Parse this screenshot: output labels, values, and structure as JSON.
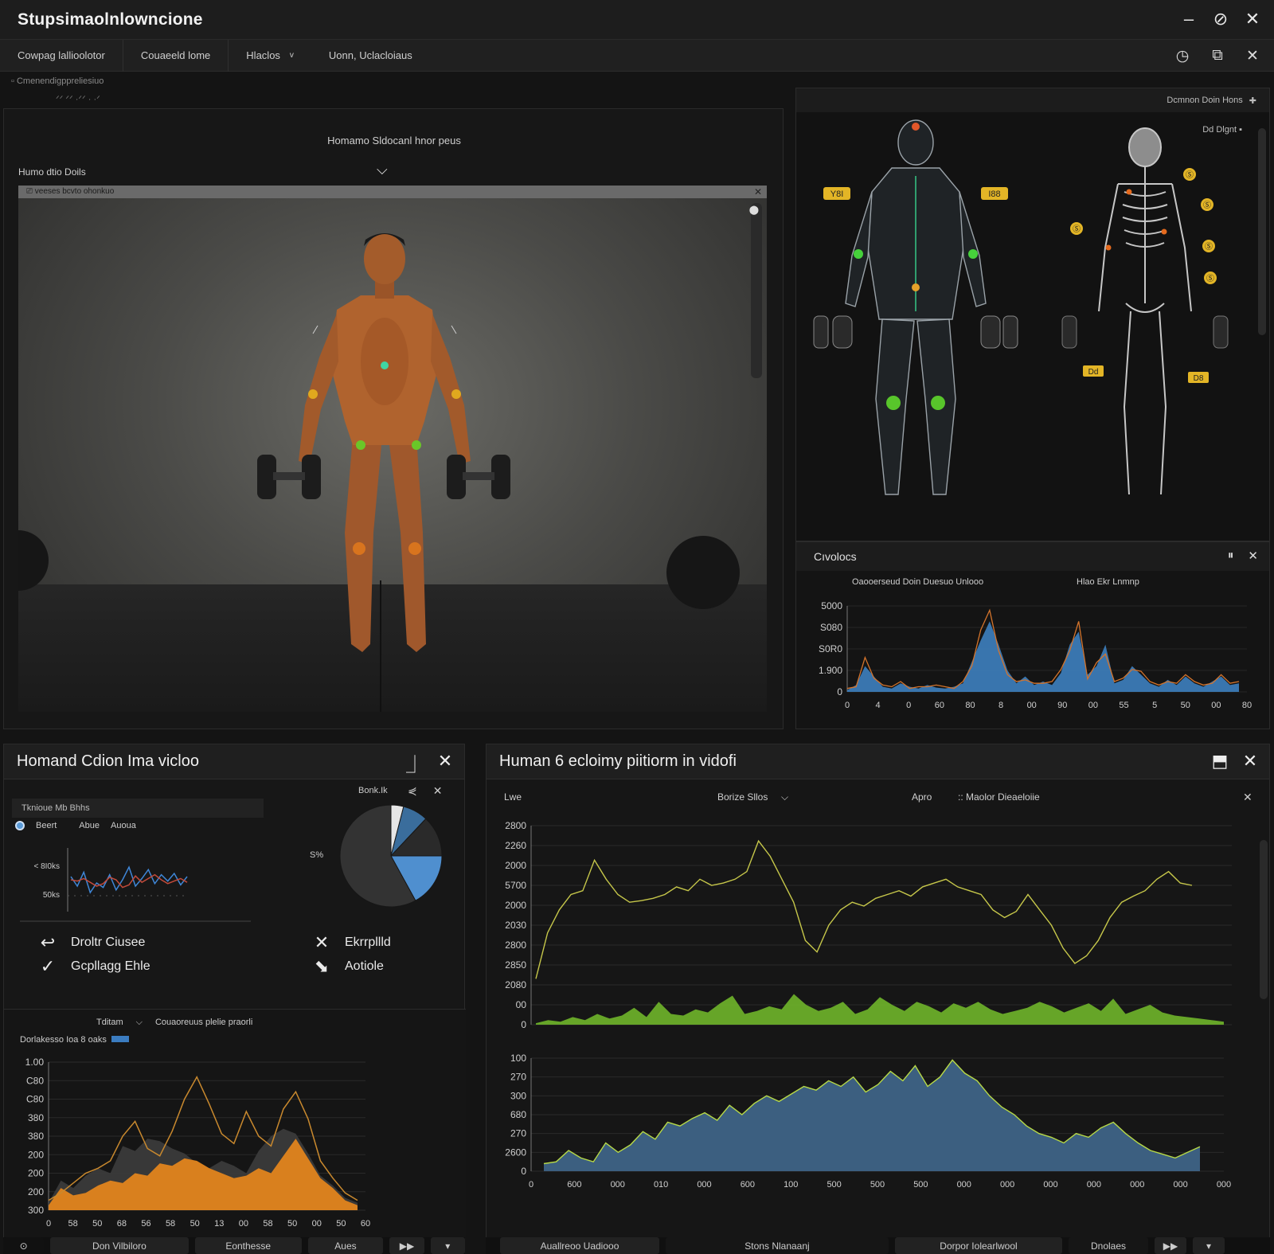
{
  "app": {
    "title": "Stupsimaolnlowncione",
    "window_controls": {
      "minimize": "–",
      "pin": "⊘",
      "close": "✕"
    }
  },
  "menu": {
    "items": [
      "Cowpag lallioolotor",
      "Couaeeld lome",
      "Hlaclos",
      "Uonn, Uclacloiaus"
    ],
    "dropdown_glyph": "v",
    "controls": {
      "history": "◷",
      "capture": "⧉",
      "close": "✕"
    }
  },
  "breadcrumb": {
    "text": "▫  Cmenendigppreliesiuo",
    "sub": "ᐟᐟ  ᐟᐟ ·ᐟᐟ  · ·ᐟ"
  },
  "video_panel": {
    "heading": "Homamo Sldocanl hnor peus",
    "subheading": "Humo dtio Doils",
    "chevron": "⌵",
    "strip_label": "⎚ veeses bcvto ohonkuo",
    "strip_close": "✕",
    "scroll_icon": "⬤"
  },
  "anatomy_panel": {
    "top_label": "Dcmnon  Doin Hons",
    "top_icon": "✚",
    "side_label": "Dd Dlgnt  ▪",
    "muscle_tags": [
      "Y8I",
      "I88"
    ],
    "skeleton_tags": [
      "Ⓢ",
      "Ⓢ",
      "Ⓢ",
      "Ⓢ",
      "Ⓢ",
      "Dd",
      "D8"
    ]
  },
  "cycle_panel": {
    "title": "Cıvolocs",
    "icons": {
      "pause": "⏸",
      "close": "✕"
    },
    "caption_left": "Oaooerseud Doin Duesuo Unlooo",
    "caption_right": "Hlao  Ekr Lnmnp",
    "chart_data": {
      "type": "area",
      "y_ticks": [
        "5000",
        "S080",
        "S0R0",
        "1.900",
        "0"
      ],
      "x_ticks": [
        "0",
        "4",
        "0",
        "60",
        "80",
        "8",
        "00",
        "90",
        "00",
        "55",
        "5",
        "50",
        "00",
        "80"
      ],
      "series": [
        {
          "values": [
            2,
            8,
            30,
            18,
            6,
            4,
            10,
            6,
            4,
            8,
            5,
            4,
            6,
            10,
            35,
            60,
            82,
            55,
            25,
            10,
            18,
            8,
            12,
            8,
            22,
            55,
            70,
            20,
            30,
            55,
            10,
            14,
            30,
            20,
            10,
            6,
            14,
            8,
            18,
            10,
            6,
            12,
            18,
            8,
            10
          ]
        },
        {
          "values": [
            4,
            6,
            40,
            16,
            8,
            6,
            12,
            4,
            6,
            6,
            8,
            6,
            4,
            12,
            30,
            72,
            95,
            48,
            20,
            12,
            14,
            10,
            10,
            12,
            26,
            48,
            82,
            15,
            34,
            44,
            12,
            16,
            26,
            24,
            12,
            8,
            12,
            10,
            20,
            12,
            8,
            10,
            20,
            10,
            12
          ]
        }
      ],
      "colors": [
        "#3d7fbf",
        "#d4742c"
      ],
      "ylim": [
        0,
        100
      ]
    }
  },
  "bl_panel": {
    "title": "Homand Cdion Ima vicloo",
    "icons": {
      "dock": "⏌",
      "close": "✕"
    },
    "sub_label": "Tknioue Mb Bhhs",
    "pie_label": "Bonk.Ik",
    "pie_icons": {
      "back": "⋞",
      "close": "✕"
    },
    "legend": {
      "a": "Beert",
      "b": "Abue",
      "c": "Auoua"
    },
    "mini_chart": {
      "y_ticks": [
        "< 8I0ks",
        "50ks"
      ],
      "series": [
        {
          "values": [
            55,
            40,
            62,
            30,
            45,
            38,
            58,
            34,
            50,
            70,
            40,
            52,
            66,
            44,
            58,
            48,
            60,
            42,
            55
          ],
          "color": "#3f87d8"
        },
        {
          "values": [
            50,
            48,
            52,
            46,
            40,
            44,
            54,
            50,
            38,
            42,
            56,
            46,
            52,
            58,
            50,
            44,
            48,
            52,
            46
          ],
          "color": "#c24a3a"
        }
      ]
    },
    "pie": {
      "slices": [
        0.04,
        0.08,
        0.13,
        0.17,
        0.58
      ],
      "colors": [
        "#e6e6e6",
        "#3a6d9c",
        "#2a2a2a",
        "#4f8fcf",
        "#333333"
      ],
      "left_label": "S%"
    },
    "actions": [
      {
        "icon": "↩",
        "label": "Droltr Ciusee"
      },
      {
        "icon": "✓",
        "label": "Gcpllagg Ehle"
      },
      {
        "icon": "✕",
        "label": "Ekrrpllld"
      },
      {
        "icon": "⬊",
        "label": "Aotiole"
      }
    ],
    "filter": {
      "a": "Tditam",
      "b": "⌵",
      "c": "Couaoreuus plelie praorli"
    },
    "range_label": "Dorlakesso Ioa 8 oaks",
    "area_chart": {
      "type": "area",
      "y_ticks": [
        "1.00",
        "C80",
        "C80",
        "380",
        "380",
        "200",
        "200",
        "200",
        "300"
      ],
      "x_ticks": [
        "0",
        "58",
        "50",
        "68",
        "56",
        "58",
        "50",
        "13",
        "00",
        "58",
        "50",
        "00",
        "50",
        "60"
      ],
      "series": [
        {
          "name": "",
          "values": [
            4,
            18,
            12,
            14,
            20,
            24,
            22,
            30,
            28,
            38,
            36,
            42,
            40,
            34,
            30,
            26,
            28,
            34,
            30,
            44,
            58,
            42,
            26,
            18,
            8,
            4
          ],
          "color": "#d9801e"
        },
        {
          "name": "",
          "values": [
            6,
            24,
            18,
            28,
            34,
            30,
            52,
            48,
            58,
            56,
            50,
            46,
            38,
            34,
            40,
            36,
            30,
            48,
            60,
            66,
            62,
            46,
            28,
            20,
            10,
            6
          ],
          "color": "#3a3a3a"
        },
        {
          "name": "",
          "values": [
            8,
            14,
            22,
            30,
            34,
            40,
            60,
            72,
            50,
            44,
            64,
            90,
            108,
            86,
            62,
            54,
            80,
            60,
            52,
            82,
            96,
            74,
            40,
            26,
            14,
            8
          ],
          "color": "#c9892e"
        }
      ],
      "ylim": [
        0,
        120
      ]
    },
    "footer": [
      "⊙",
      "Don Vilbiloro",
      "Eonthesse",
      "Aues",
      "▶▶",
      "▾"
    ]
  },
  "br_panel": {
    "title": "Human 6 ecloimy piitiorm in vidofi",
    "icons": {
      "maximize": "⬒",
      "close": "✕"
    },
    "toolbar": {
      "left": "Lwe",
      "mid": "Borize Sllos",
      "mid_chevron": "⌵",
      "right1": "Apro",
      "right2": "::  Maolor Dieaeloiie",
      "close": "✕"
    },
    "top_chart": {
      "type": "line",
      "y_ticks": [
        "2800",
        "2260",
        "2000",
        "5700",
        "2000",
        "2030",
        "2800",
        "2850",
        "2080",
        "00",
        "0"
      ],
      "series": [
        {
          "name": "",
          "values": [
            60,
            120,
            150,
            170,
            175,
            215,
            190,
            170,
            160,
            162,
            165,
            170,
            180,
            175,
            190,
            182,
            185,
            190,
            200,
            240,
            220,
            190,
            160,
            110,
            95,
            130,
            150,
            160,
            155,
            165,
            170,
            175,
            168,
            180,
            185,
            190,
            180,
            175,
            170,
            150,
            140,
            148,
            170,
            150,
            130,
            100,
            80,
            90,
            110,
            140,
            160,
            168,
            175,
            190,
            200,
            185,
            182
          ],
          "color": "#c6c74a"
        },
        {
          "name": "",
          "values": [
            2,
            6,
            4,
            10,
            6,
            14,
            8,
            12,
            22,
            10,
            30,
            14,
            12,
            20,
            16,
            28,
            38,
            14,
            18,
            24,
            20,
            40,
            26,
            18,
            22,
            30,
            14,
            20,
            36,
            26,
            18,
            30,
            24,
            16,
            28,
            22,
            30,
            20,
            14,
            18,
            22,
            30,
            24,
            16,
            22,
            28,
            18,
            34,
            14,
            20,
            26,
            16,
            12,
            10,
            8,
            6,
            4
          ],
          "color": "#6fb52a"
        }
      ],
      "ylim": [
        0,
        260
      ]
    },
    "bottom_chart": {
      "type": "area",
      "y_ticks": [
        "100",
        "270",
        "300",
        "680",
        "270",
        "2600",
        "0"
      ],
      "x_ticks": [
        "0",
        "600",
        "000",
        "010",
        "000",
        "600",
        "100",
        "500",
        "500",
        "500",
        "000",
        "000",
        "000",
        "000",
        "000",
        "000",
        "000"
      ],
      "series": [
        {
          "name": "",
          "values": [
            8,
            10,
            22,
            14,
            10,
            30,
            20,
            28,
            42,
            34,
            52,
            48,
            56,
            62,
            54,
            70,
            60,
            72,
            80,
            74,
            82,
            90,
            86,
            96,
            90,
            100,
            84,
            92,
            106,
            96,
            112,
            90,
            100,
            118,
            104,
            96,
            80,
            68,
            60,
            48,
            40,
            36,
            30,
            40,
            36,
            46,
            52,
            40,
            30,
            22,
            18,
            14,
            20,
            26
          ],
          "color": "#3c5f80",
          "stroke": "#b7d947"
        }
      ],
      "ylim": [
        0,
        120
      ]
    },
    "footer": [
      "Auallreoo Uadiooo",
      "Stons Nlanaanj",
      "Dorpor Iolearlwool",
      "Dnolaes",
      "▶▶",
      "▾"
    ]
  },
  "colors": {
    "accent_blue": "#3d7fbf",
    "accent_orange": "#d4742c",
    "accent_green": "#6fb52a",
    "accent_yellow": "#c6c74a",
    "tag_yellow": "#e3b526"
  }
}
